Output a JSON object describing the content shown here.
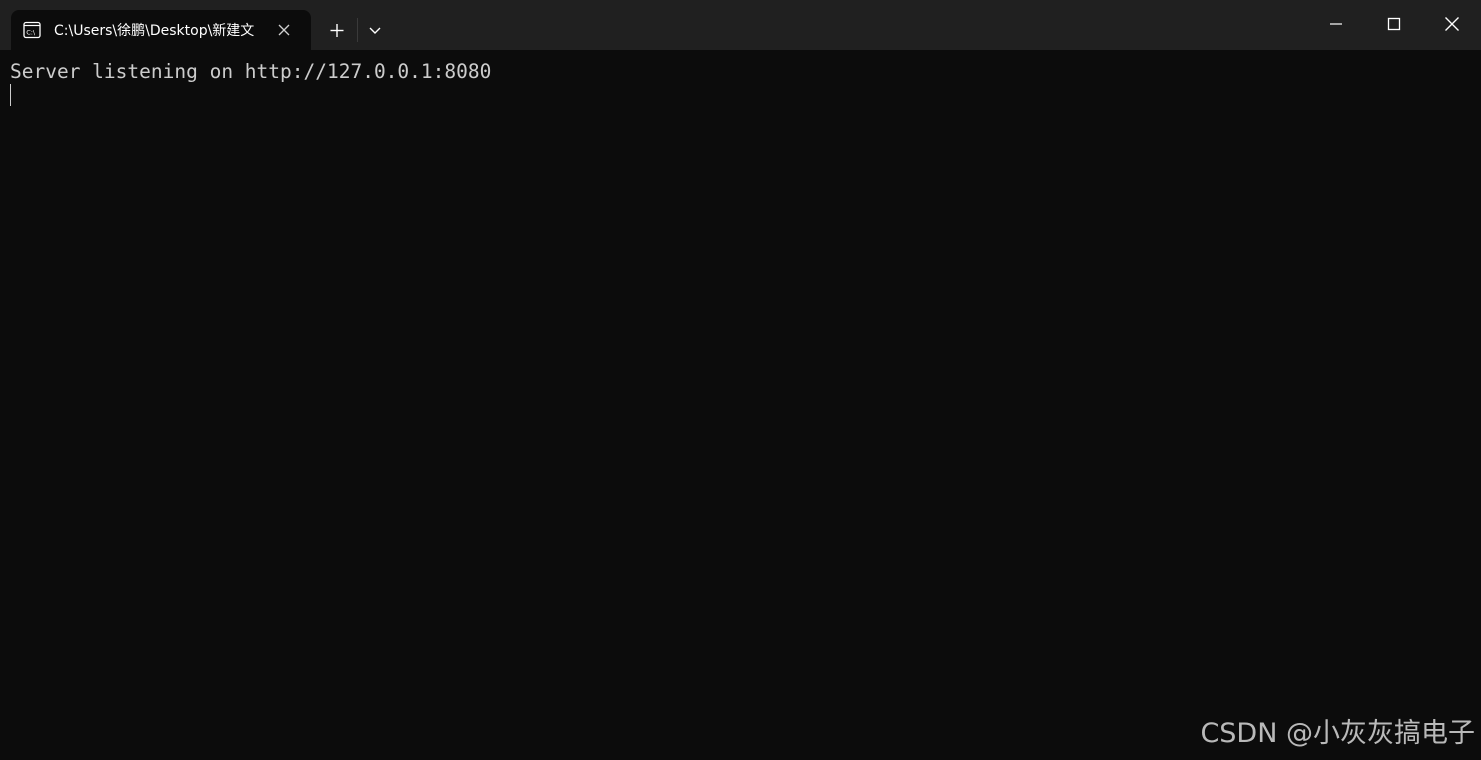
{
  "titlebar": {
    "tab": {
      "title": "C:\\Users\\徐鹏\\Desktop\\新建文",
      "icon": "terminal-icon",
      "close_icon": "close-icon"
    },
    "new_tab_icon": "plus-icon",
    "dropdown_icon": "chevron-down-icon",
    "window_controls": {
      "minimize_icon": "minimize-icon",
      "maximize_icon": "maximize-icon",
      "close_icon": "close-icon"
    }
  },
  "terminal": {
    "lines": [
      "Server listening on http://127.0.0.1:8080"
    ],
    "background_color": "#0c0c0c",
    "text_color": "#cccccc"
  },
  "watermark": {
    "text": "CSDN @小灰灰搞电子"
  },
  "colors": {
    "titlebar": "#202020",
    "tab_active": "#0c0c0c",
    "foreground": "#ffffff"
  }
}
